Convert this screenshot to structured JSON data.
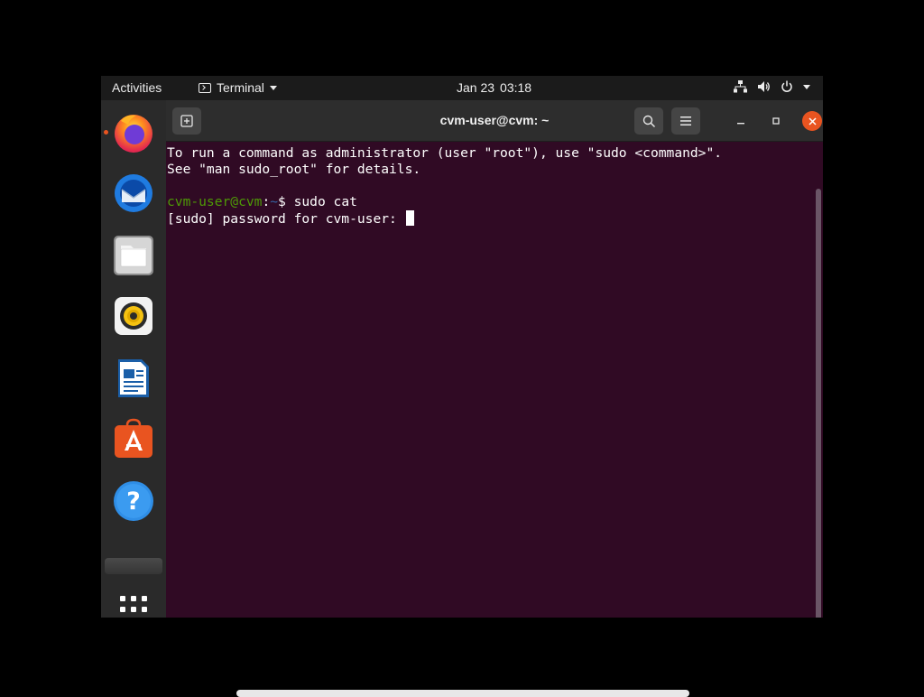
{
  "topbar": {
    "activities": "Activities",
    "app_name": "Terminal",
    "date": "Jan 23",
    "time": "03:18",
    "tray_icons": [
      "network-icon",
      "volume-icon",
      "power-icon",
      "chevron-down-icon"
    ]
  },
  "dock": {
    "items": [
      {
        "name": "Firefox",
        "icon": "firefox-icon"
      },
      {
        "name": "Thunderbird",
        "icon": "thunderbird-icon"
      },
      {
        "name": "Files",
        "icon": "files-icon"
      },
      {
        "name": "Rhythmbox",
        "icon": "rhythmbox-icon"
      },
      {
        "name": "LibreOffice Writer",
        "icon": "writer-icon"
      },
      {
        "name": "Ubuntu Software",
        "icon": "software-center-icon"
      },
      {
        "name": "Help",
        "icon": "help-icon"
      },
      {
        "name": "Show Applications",
        "icon": "app-grid-icon"
      }
    ]
  },
  "window": {
    "title": "cvm-user@cvm: ~",
    "new_tab_icon": "new-tab-icon",
    "search_icon": "search-icon",
    "menu_icon": "hamburger-menu-icon"
  },
  "terminal": {
    "line1": "To run a command as administrator (user \"root\"), use \"sudo <command>\".",
    "line2": "See \"man sudo_root\" for details.",
    "prompt_user": "cvm-user@cvm",
    "prompt_colon": ":",
    "prompt_path": "~",
    "prompt_symbol": "$ ",
    "command": "sudo cat",
    "password_prompt": "[sudo] password for cvm-user: "
  },
  "colors": {
    "terminal_bg": "#300a24",
    "accent": "#e95420",
    "prompt_user": "#4e9a06",
    "prompt_path": "#3465a4"
  }
}
